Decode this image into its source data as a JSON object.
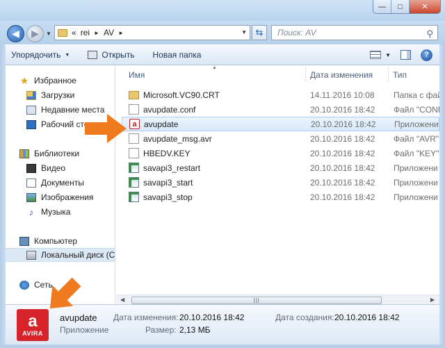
{
  "window": {
    "minimize_glyph": "—",
    "maximize_glyph": "□",
    "close_glyph": "✕"
  },
  "address": {
    "crumbs": [
      "«",
      "rei",
      "►",
      "AV",
      "►"
    ],
    "search_placeholder": "Поиск: AV"
  },
  "toolbar": {
    "organize_label": "Упорядочить",
    "open_label": "Открыть",
    "new_folder_label": "Новая папка"
  },
  "nav": {
    "favorites": "Избранное",
    "downloads": "Загрузки",
    "recent": "Недавние места",
    "desktop": "Рабочий стол",
    "libraries": "Библиотеки",
    "video": "Видео",
    "documents": "Документы",
    "pictures": "Изображения",
    "music": "Музыка",
    "computer": "Компьютер",
    "local_disk": "Локальный диск (С",
    "network": "Сеть"
  },
  "columns": {
    "name": "Имя",
    "date": "Дата изменения",
    "type": "Тип"
  },
  "files": [
    {
      "name": "Microsoft.VC90.CRT",
      "date": "14.11.2016 10:08",
      "type": "Папка с фай",
      "icon": "folder-icon"
    },
    {
      "name": "avupdate.conf",
      "date": "20.10.2016 18:42",
      "type": "Файл \"CONF",
      "icon": "file-icon"
    },
    {
      "name": "avupdate",
      "date": "20.10.2016 18:42",
      "type": "Приложени",
      "icon": "avira-icon"
    },
    {
      "name": "avupdate_msg.avr",
      "date": "20.10.2016 18:42",
      "type": "Файл \"AVR\"",
      "icon": "file-icon"
    },
    {
      "name": "HBEDV.KEY",
      "date": "20.10.2016 18:42",
      "type": "Файл \"KEY\"",
      "icon": "file-icon"
    },
    {
      "name": "savapi3_restart",
      "date": "20.10.2016 18:42",
      "type": "Приложени",
      "icon": "app-icon"
    },
    {
      "name": "savapi3_start",
      "date": "20.10.2016 18:42",
      "type": "Приложени",
      "icon": "app-icon"
    },
    {
      "name": "savapi3_stop",
      "date": "20.10.2016 18:42",
      "type": "Приложени",
      "icon": "app-icon"
    }
  ],
  "details": {
    "icon_text": "AVIRA",
    "name": "avupdate",
    "kind": "Приложение",
    "modified_label": "Дата изменения:",
    "modified_value": "20.10.2016 18:42",
    "created_label": "Дата создания:",
    "created_value": "20.10.2016 18:42",
    "size_label": "Размер:",
    "size_value": "2,13 МБ"
  },
  "colors": {
    "accent": "#2a63b3",
    "annotation_arrow": "#f07a1f",
    "avira_red": "#d7242a"
  }
}
